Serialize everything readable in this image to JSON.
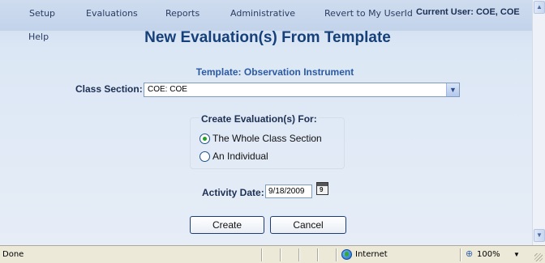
{
  "menu": {
    "items": [
      "Setup",
      "Evaluations",
      "Reports",
      "Administrative",
      "Revert to My UserId"
    ],
    "help": "Help",
    "current_user": "Current User: COE, COE"
  },
  "page_title": "New Evaluation(s) From Template",
  "template_label": "Template: Observation Instrument",
  "class_section": {
    "label": "Class Section:",
    "selected_value": "COE: COE"
  },
  "create_for": {
    "legend": "Create Evaluation(s) For:",
    "options": [
      {
        "label": "The Whole Class Section",
        "selected": true
      },
      {
        "label": "An Individual",
        "selected": false
      }
    ]
  },
  "activity_date": {
    "label": "Activity Date:",
    "value": "9/18/2009",
    "calendar_glyph": "9"
  },
  "buttons": {
    "create": "Create",
    "cancel": "Cancel"
  },
  "status_bar": {
    "status": "Done",
    "zone": "Internet",
    "zoom": "100%"
  },
  "icons": {
    "select_arrow": "chevron-down-icon",
    "calendar": "calendar-icon",
    "zone": "globe-icon",
    "zoom": "zoom-icon"
  },
  "colors": {
    "title": "#16407a",
    "template_label": "#2b5aa3",
    "radio_selected": "#21a121",
    "menubar": "#c9d9ee"
  }
}
